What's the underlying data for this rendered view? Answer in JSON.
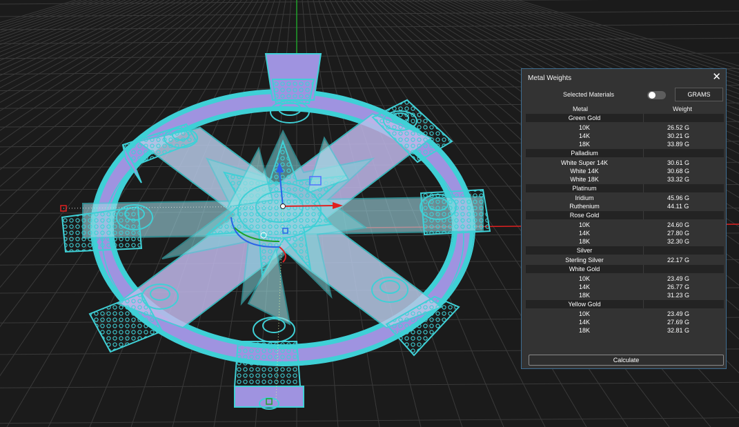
{
  "panel": {
    "title": "Metal Weights",
    "close_icon": "close-icon",
    "selected_materials_label": "Selected Materials",
    "toggle_state": "off",
    "units_button": "GRAMS",
    "columns": {
      "metal": "Metal",
      "weight": "Weight"
    },
    "groups": [
      {
        "name": "Green Gold",
        "items": [
          {
            "name": "10K",
            "weight": "26.52 G"
          },
          {
            "name": "14K",
            "weight": "30.21 G"
          },
          {
            "name": "18K",
            "weight": "33.89 G"
          }
        ]
      },
      {
        "name": "Palladium",
        "items": [
          {
            "name": "White Super 14K",
            "weight": "30.61 G"
          },
          {
            "name": "White 14K",
            "weight": "30.68 G"
          },
          {
            "name": "White 18K",
            "weight": "33.32 G"
          }
        ]
      },
      {
        "name": "Platinum",
        "items": [
          {
            "name": "Iridium",
            "weight": "45.96 G"
          },
          {
            "name": "Ruthenium",
            "weight": "44.11 G"
          }
        ]
      },
      {
        "name": "Rose Gold",
        "items": [
          {
            "name": "10K",
            "weight": "24.60 G"
          },
          {
            "name": "14K",
            "weight": "27.80 G"
          },
          {
            "name": "18K",
            "weight": "32.30 G"
          }
        ]
      },
      {
        "name": "Silver",
        "items": [
          {
            "name": "Sterling Silver",
            "weight": "22.17 G"
          }
        ]
      },
      {
        "name": "White Gold",
        "items": [
          {
            "name": "10K",
            "weight": "23.49 G"
          },
          {
            "name": "14K",
            "weight": "26.77 G"
          },
          {
            "name": "18K",
            "weight": "31.23 G"
          }
        ]
      },
      {
        "name": "Yellow Gold",
        "items": [
          {
            "name": "10K",
            "weight": "23.49 G"
          },
          {
            "name": "14K",
            "weight": "27.69 G"
          },
          {
            "name": "18K",
            "weight": "32.81 G"
          }
        ]
      }
    ],
    "calculate_button": "Calculate"
  },
  "colors": {
    "background": "#1b1b1b",
    "grid": "#3a3a3a",
    "wireframe": "#3fd0d6",
    "surface": "#9f93e0",
    "x_axis": "#e02020",
    "y_axis": "#1fa12a",
    "z_axis": "#2a62e8",
    "panel_bg": "#333333",
    "panel_border": "#3f6f93"
  }
}
